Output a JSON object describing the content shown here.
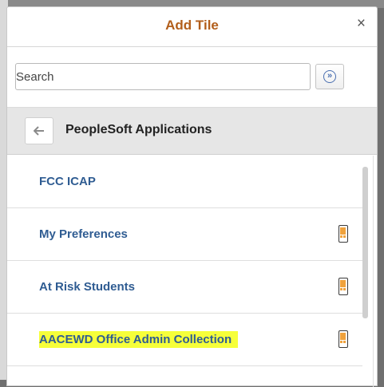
{
  "dialog": {
    "title": "Add Tile",
    "close_symbol": "×"
  },
  "search": {
    "placeholder": "Search",
    "value": "",
    "button_icon": "double-chevron-right-icon"
  },
  "folder": {
    "back_icon": "arrow-left-icon",
    "label": "PeopleSoft Applications"
  },
  "tiles": [
    {
      "label": "FCC ICAP",
      "icon": null,
      "highlighted": false
    },
    {
      "label": "My Preferences",
      "icon": "mobile-device-icon",
      "highlighted": false
    },
    {
      "label": "At Risk Students",
      "icon": "mobile-device-icon",
      "highlighted": false
    },
    {
      "label": "AACEWD Office Admin Collection",
      "icon": "mobile-device-icon",
      "highlighted": true
    }
  ],
  "colors": {
    "title": "#b25e1b",
    "link": "#2f5c92",
    "highlight": "#f6ff3a",
    "device_icon_accent": "#f0a23c"
  }
}
